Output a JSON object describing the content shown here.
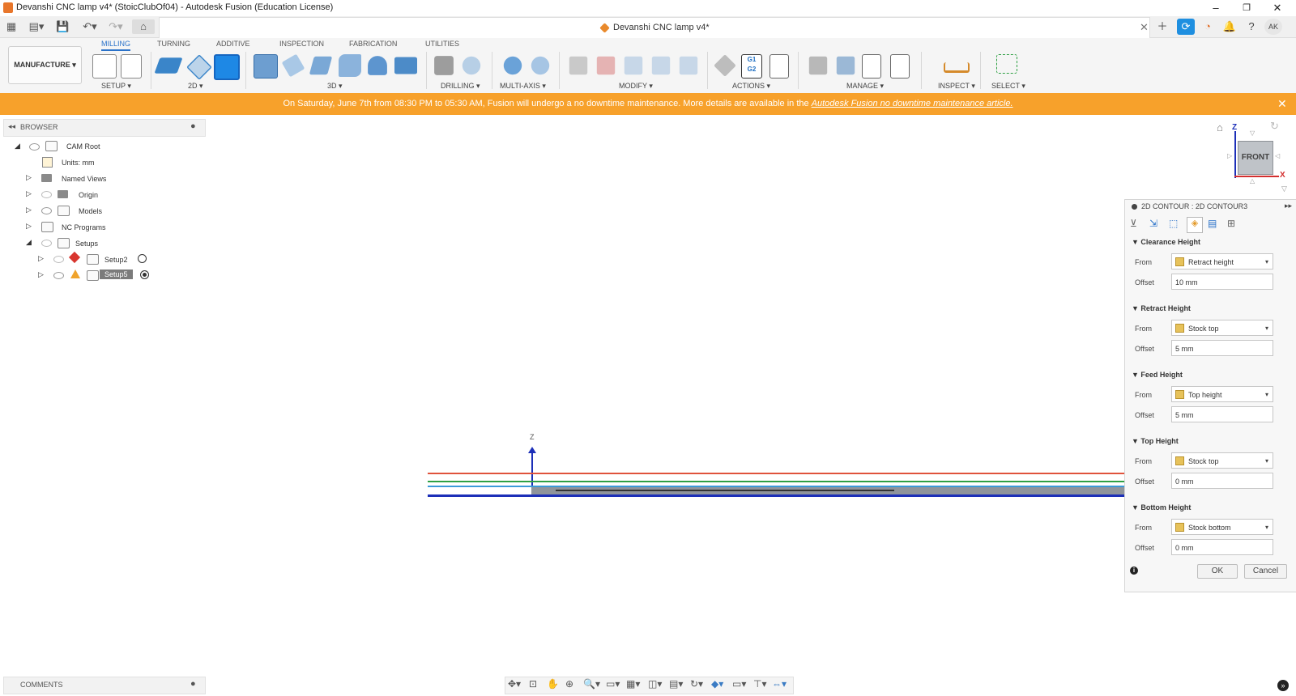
{
  "window": {
    "title": "Devanshi CNC lamp v4* (StoicClubOf04) - Autodesk Fusion (Education License)",
    "controls": [
      "–",
      "❐",
      "✕"
    ]
  },
  "doc_tab": {
    "label": "Devanshi CNC lamp v4*"
  },
  "user": {
    "initials": "AK"
  },
  "ribbon": {
    "workspace": "MANUFACTURE",
    "tabs": [
      {
        "label": "MILLING",
        "active": true
      },
      {
        "label": "TURNING"
      },
      {
        "label": "ADDITIVE"
      },
      {
        "label": "INSPECTION"
      },
      {
        "label": "FABRICATION"
      },
      {
        "label": "UTILITIES"
      }
    ],
    "groups": {
      "setup": "SETUP",
      "twod": "2D",
      "threed": "3D",
      "drilling": "DRILLING",
      "multiaxis": "MULTI-AXIS",
      "modify": "MODIFY",
      "actions": "ACTIONS",
      "manage": "MANAGE",
      "inspect": "INSPECT",
      "select": "SELECT"
    },
    "g1g2_label": "G1\nG2"
  },
  "banner": {
    "text": "On Saturday, June 7th from 08:30 PM to 05:30 AM, Fusion will undergo a no downtime maintenance. More details are available in the ",
    "link": "Autodesk Fusion no downtime maintenance article."
  },
  "browser": {
    "header": "BROWSER",
    "items": [
      {
        "label": "CAM Root"
      },
      {
        "label": "Units: mm"
      },
      {
        "label": "Named Views"
      },
      {
        "label": "Origin"
      },
      {
        "label": "Models"
      },
      {
        "label": "NC Programs"
      },
      {
        "label": "Setups"
      },
      {
        "label": "Setup2"
      },
      {
        "label": "Setup5"
      }
    ]
  },
  "viewcube": {
    "face": "FRONT",
    "axis_z": "Z",
    "axis_x": "X"
  },
  "viewport": {
    "axis_label": "Z"
  },
  "panel": {
    "title": "2D CONTOUR : 2D CONTOUR3",
    "from_label": "From",
    "offset_label": "Offset",
    "sections": [
      {
        "name": "Clearance Height",
        "from": "Retract height",
        "offset": "10 mm"
      },
      {
        "name": "Retract Height",
        "from": "Stock top",
        "offset": "5 mm"
      },
      {
        "name": "Feed Height",
        "from": "Top height",
        "offset": "5 mm"
      },
      {
        "name": "Top Height",
        "from": "Stock top",
        "offset": "0 mm"
      },
      {
        "name": "Bottom Height",
        "from": "Stock bottom",
        "offset": "0 mm"
      }
    ],
    "ok": "OK",
    "cancel": "Cancel"
  },
  "comments": {
    "header": "COMMENTS"
  },
  "colors": {
    "banner": "#f7a12b",
    "accent": "#2a72c9",
    "stock_top": "#e0533c",
    "model_top": "#2ea043",
    "feed": "#3b9ad9",
    "bottom": "#1c2fb8"
  }
}
